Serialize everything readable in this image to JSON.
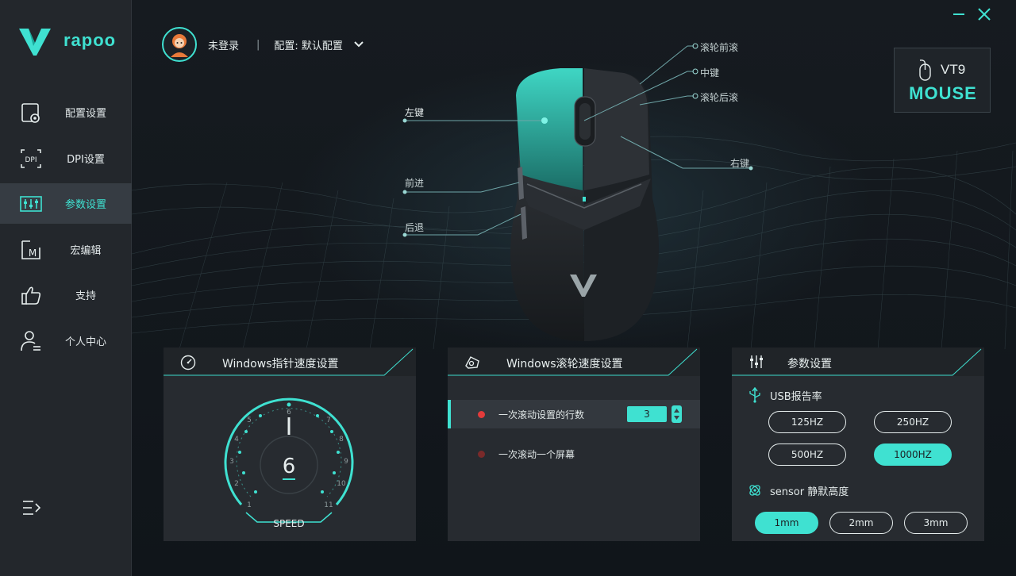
{
  "app": {
    "brand": "rapoo",
    "accent": "#3fe1d1"
  },
  "sidebar": {
    "items": [
      {
        "label": "配置设置",
        "icon": "profile-settings-icon"
      },
      {
        "label": "DPI设置",
        "icon": "dpi-icon",
        "icon_text": "DPI"
      },
      {
        "label": "参数设置",
        "icon": "parameters-icon",
        "active": true
      },
      {
        "label": "宏编辑",
        "icon": "macro-icon",
        "icon_text": "M"
      },
      {
        "label": "支持",
        "icon": "thumbs-up-icon"
      },
      {
        "label": "个人中心",
        "icon": "user-center-icon"
      }
    ],
    "collapse_icon": "menu-collapse-icon"
  },
  "window": {
    "minimize_icon": "minimize-icon",
    "close_icon": "close-icon"
  },
  "header": {
    "user_name": "未登录",
    "separator": "|",
    "profile": "配置: 默认配置"
  },
  "device": {
    "model": "VT9",
    "type": "MOUSE"
  },
  "mouse_callouts": {
    "left_button": "左键",
    "forward": "前进",
    "back": "后退",
    "scroll_up": "滚轮前滚",
    "middle": "中键",
    "scroll_down": "滚轮后滚",
    "right_button": "右键"
  },
  "pointer_speed": {
    "title": "Windows指针速度设置",
    "value": "6",
    "label": "SPEED",
    "ticks": [
      "1",
      "2",
      "3",
      "4",
      "5",
      "6",
      "7",
      "8",
      "9",
      "10",
      "11"
    ]
  },
  "scroll_speed": {
    "title": "Windows滚轮速度设置",
    "options": [
      {
        "label": "一次滚动设置的行数",
        "selected": true,
        "value": "3"
      },
      {
        "label": "一次滚动一个屏幕",
        "selected": false
      }
    ]
  },
  "parameters": {
    "title": "参数设置",
    "usb_rate_label": "USB报告率",
    "usb_rates": [
      {
        "label": "125HZ",
        "on": false
      },
      {
        "label": "250HZ",
        "on": false
      },
      {
        "label": "500HZ",
        "on": false
      },
      {
        "label": "1000HZ",
        "on": true
      }
    ],
    "lod_label": "sensor 静默高度",
    "lod_options": [
      {
        "label": "1mm",
        "on": true
      },
      {
        "label": "2mm",
        "on": false
      },
      {
        "label": "3mm",
        "on": false
      }
    ]
  }
}
